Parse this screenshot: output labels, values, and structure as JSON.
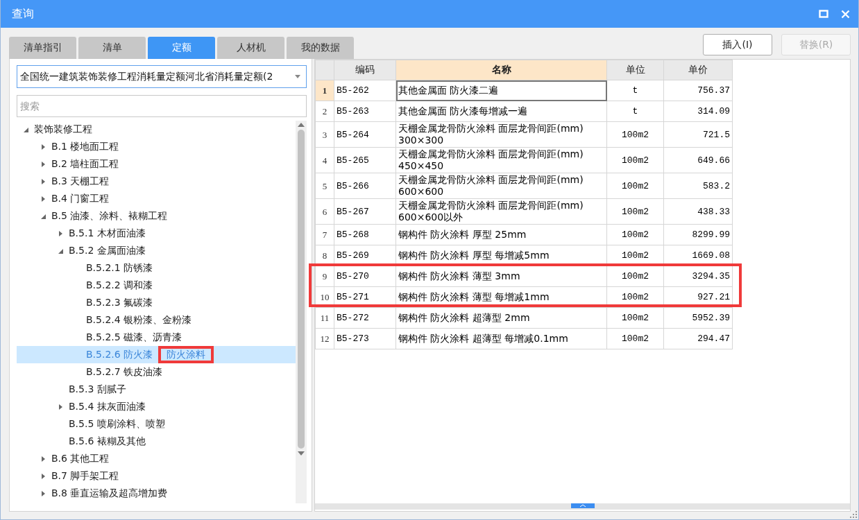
{
  "window": {
    "title": "查询"
  },
  "tabs": [
    {
      "label": "清单指引",
      "selected": false
    },
    {
      "label": "清单",
      "selected": false
    },
    {
      "label": "定额",
      "selected": true
    },
    {
      "label": "人材机",
      "selected": false
    },
    {
      "label": "我的数据",
      "selected": false
    }
  ],
  "actions": [
    {
      "label": "插入(I)",
      "disabled": false
    },
    {
      "label": "替换(R)",
      "disabled": true
    }
  ],
  "library_select": {
    "value": "全国统一建筑装饰装修工程消耗量定额河北省消耗量定额(2"
  },
  "search": {
    "placeholder": "搜索"
  },
  "tree": [
    {
      "label": "装饰装修工程",
      "expanded": true,
      "selected": false,
      "children": [
        {
          "label": "B.1 楼地面工程",
          "expanded": false,
          "selected": false
        },
        {
          "label": "B.2 墙柱面工程",
          "expanded": false,
          "selected": false
        },
        {
          "label": "B.3 天棚工程",
          "expanded": false,
          "selected": false
        },
        {
          "label": "B.4 门窗工程",
          "expanded": false,
          "selected": false
        },
        {
          "label": "B.5 油漆、涂料、裱糊工程",
          "expanded": true,
          "selected": false,
          "children": [
            {
              "label": "B.5.1 木材面油漆",
              "expanded": false,
              "selected": false
            },
            {
              "label": "B.5.2 金属面油漆",
              "expanded": true,
              "selected": false,
              "children": [
                {
                  "label": "B.5.2.1 防锈漆",
                  "selected": false
                },
                {
                  "label": "B.5.2.2 调和漆",
                  "selected": false
                },
                {
                  "label": "B.5.2.3 氟碳漆",
                  "selected": false
                },
                {
                  "label": "B.5.2.4 银粉漆、金粉漆",
                  "selected": false
                },
                {
                  "label": "B.5.2.5 磁漆、沥青漆",
                  "selected": false
                },
                {
                  "label": "B.5.2.6 防火漆",
                  "selected": true,
                  "note": "防火涂料"
                },
                {
                  "label": "B.5.2.7 铁皮油漆",
                  "selected": false
                }
              ]
            },
            {
              "label": "B.5.3 刮腻子",
              "selected": false
            },
            {
              "label": "B.5.4 抹灰面油漆",
              "expanded": false,
              "selected": false
            },
            {
              "label": "B.5.5 喷刷涂料、喷塑",
              "selected": false
            },
            {
              "label": "B.5.6 裱糊及其他",
              "selected": false
            }
          ]
        },
        {
          "label": "B.6 其他工程",
          "expanded": false,
          "selected": false
        },
        {
          "label": "B.7 脚手架工程",
          "expanded": false,
          "selected": false
        },
        {
          "label": "B.8 垂直运输及超高增加费",
          "expanded": false,
          "selected": false
        }
      ]
    }
  ],
  "table": {
    "columns": [
      {
        "label": "编码",
        "selected": false
      },
      {
        "label": "名称",
        "selected": true
      },
      {
        "label": "单位",
        "selected": false
      },
      {
        "label": "单价",
        "selected": false
      }
    ],
    "rows": [
      {
        "index": "1",
        "code": "B5-262",
        "name": "其他金属面 防火漆二遍",
        "unit": "t",
        "price": "756.37",
        "selected": true,
        "highlighted": false
      },
      {
        "index": "2",
        "code": "B5-263",
        "name": "其他金属面 防火漆每增减一遍",
        "unit": "t",
        "price": "314.09",
        "selected": false,
        "highlighted": false
      },
      {
        "index": "3",
        "code": "B5-264",
        "name": "天棚金属龙骨防火涂料 面层龙骨间距(mm)\n300×300",
        "unit": "100m2",
        "price": "721.5",
        "selected": false,
        "highlighted": false
      },
      {
        "index": "4",
        "code": "B5-265",
        "name": "天棚金属龙骨防火涂料 面层龙骨间距(mm)\n450×450",
        "unit": "100m2",
        "price": "649.66",
        "selected": false,
        "highlighted": false
      },
      {
        "index": "5",
        "code": "B5-266",
        "name": "天棚金属龙骨防火涂料 面层龙骨间距(mm)\n600×600",
        "unit": "100m2",
        "price": "583.2",
        "selected": false,
        "highlighted": false
      },
      {
        "index": "6",
        "code": "B5-267",
        "name": "天棚金属龙骨防火涂料 面层龙骨间距(mm)\n600×600以外",
        "unit": "100m2",
        "price": "438.33",
        "selected": false,
        "highlighted": false
      },
      {
        "index": "7",
        "code": "B5-268",
        "name": "钢构件 防火涂料 厚型 25mm",
        "unit": "100m2",
        "price": "8299.99",
        "selected": false,
        "highlighted": false
      },
      {
        "index": "8",
        "code": "B5-269",
        "name": "钢构件 防火涂料 厚型 每增减5mm",
        "unit": "100m2",
        "price": "1669.08",
        "selected": false,
        "highlighted": false
      },
      {
        "index": "9",
        "code": "B5-270",
        "name": "钢构件 防火涂料 薄型 3mm",
        "unit": "100m2",
        "price": "3294.35",
        "selected": false,
        "highlighted": true
      },
      {
        "index": "10",
        "code": "B5-271",
        "name": "钢构件 防火涂料 薄型 每增减1mm",
        "unit": "100m2",
        "price": "927.21",
        "selected": false,
        "highlighted": true
      },
      {
        "index": "11",
        "code": "B5-272",
        "name": "钢构件 防火涂料 超薄型 2mm",
        "unit": "100m2",
        "price": "5952.39",
        "selected": false,
        "highlighted": false
      },
      {
        "index": "12",
        "code": "B5-273",
        "name": "钢构件 防火涂料 超薄型 每增减0.1mm",
        "unit": "100m2",
        "price": "294.47",
        "selected": false,
        "highlighted": false
      }
    ]
  }
}
